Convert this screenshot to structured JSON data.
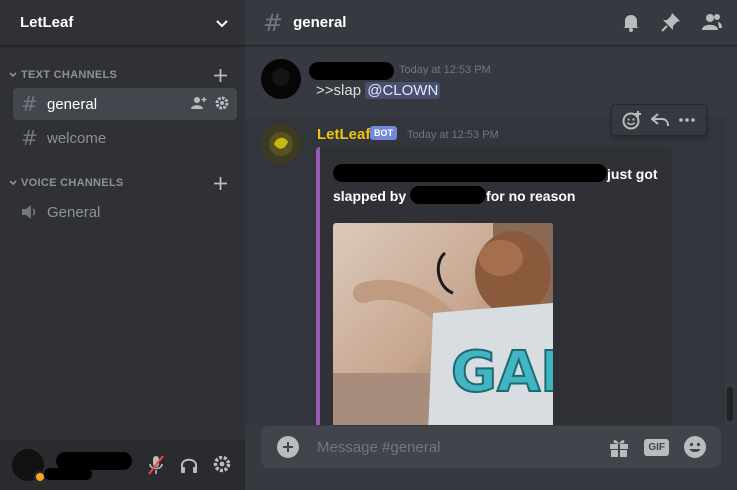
{
  "server": {
    "name": "LetLeaf"
  },
  "categories": {
    "text": "TEXT CHANNELS",
    "voice": "VOICE CHANNELS"
  },
  "channels": {
    "general": "general",
    "welcome": "welcome",
    "voice_general": "General"
  },
  "header": {
    "channel_name": "general"
  },
  "messages": [
    {
      "author": "",
      "timestamp": "Today at 12:53 PM",
      "text": ">>slap ",
      "mention": "@CLOWN"
    },
    {
      "author": "LetLeaf",
      "author_color": "#f1c40f",
      "bot_tag": "BOT",
      "timestamp": "Today at 12:53 PM",
      "embed": {
        "desc_part1": "just got",
        "desc_part2": "slapped by",
        "desc_part3": "for no reason",
        "image_letters": "GAI",
        "border_color": "#9b59b6"
      }
    }
  ],
  "composer": {
    "placeholder": "Message #general",
    "gif_label": "GIF"
  },
  "colors": {
    "accent": "#7289da",
    "idle": "#faa61a"
  },
  "icons": [
    "chevron-down-icon",
    "bell-icon",
    "pin-icon",
    "members-icon",
    "add-reaction-icon",
    "reply-icon",
    "more-icon",
    "gift-icon",
    "emoji-icon",
    "mute-icon",
    "headphones-icon",
    "gear-icon",
    "speaker-icon",
    "invite-icon"
  ]
}
